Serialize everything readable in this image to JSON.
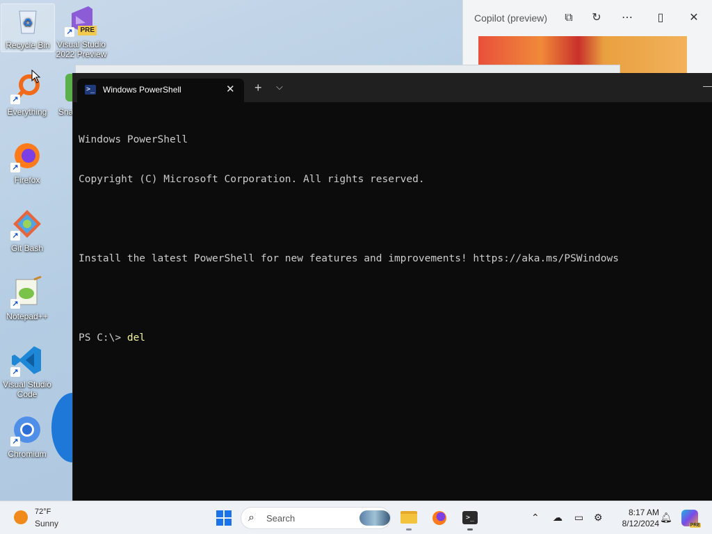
{
  "desktop": {
    "icons": [
      {
        "label": "Recycle Bin",
        "icon": "recycle-bin-icon"
      },
      {
        "label": "Visual Studio 2022 Preview",
        "icon": "visual-studio-icon",
        "badge": "PRE"
      },
      {
        "label": "Everything",
        "icon": "everything-search-icon"
      },
      {
        "label": "Sna",
        "icon": "snagit-icon"
      },
      {
        "label": "Firefox",
        "icon": "firefox-icon"
      },
      {
        "label": "Git Bash",
        "icon": "git-bash-icon"
      },
      {
        "label": "Notepad++",
        "icon": "notepad-plus-plus-icon"
      },
      {
        "label": "Visual Studio Code",
        "icon": "vscode-icon"
      },
      {
        "label": "Chromium",
        "icon": "chromium-icon"
      }
    ]
  },
  "copilot": {
    "title": "Copilot (preview)",
    "buttons": [
      "open-external-icon",
      "refresh-icon",
      "more-icon",
      "split-view-icon",
      "close-icon"
    ]
  },
  "terminal": {
    "tab_title": "Windows PowerShell",
    "lines": [
      "Windows PowerShell",
      "Copyright (C) Microsoft Corporation. All rights reserved.",
      "",
      "Install the latest PowerShell for new features and improvements! https://aka.ms/PSWindows",
      ""
    ],
    "prompt": "PS C:\\> ",
    "command": "del"
  },
  "taskbar": {
    "weather": {
      "temp": "72°F",
      "condition": "Sunny"
    },
    "search_placeholder": "Search",
    "clock": {
      "time": "8:17 AM",
      "date": "8/12/2024"
    },
    "copilot_badge": "PRE"
  },
  "colors": {
    "terminal_bg": "#0c0c0c",
    "tabbar_bg": "#202020",
    "command_text": "#f4f39c",
    "accent": "#1a73e8"
  }
}
